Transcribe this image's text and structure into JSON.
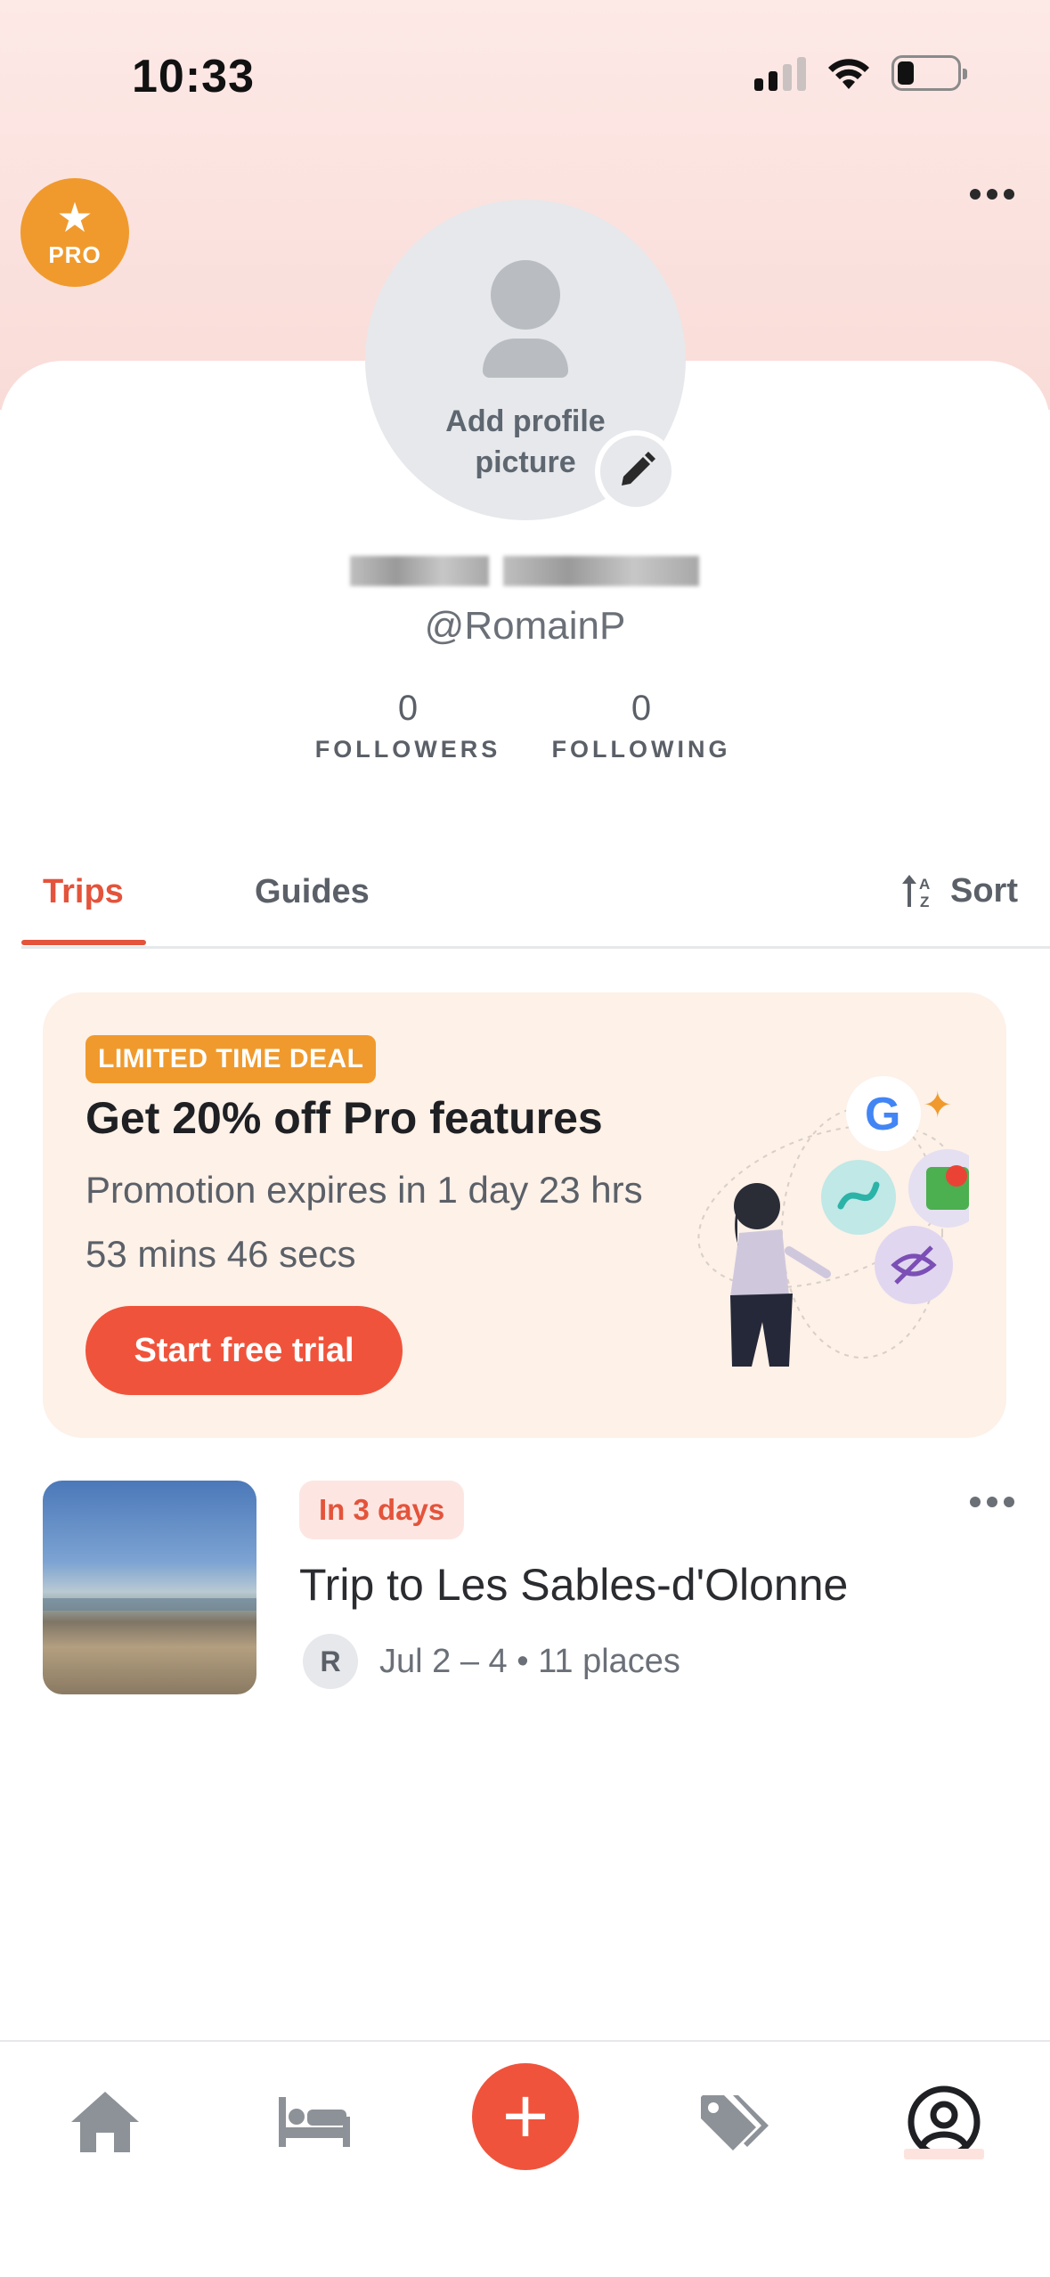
{
  "status_bar": {
    "time": "10:33"
  },
  "header": {
    "pro_label": "PRO"
  },
  "profile": {
    "add_picture_text": "Add profile picture",
    "handle": "@RomainP",
    "followers_count": "0",
    "followers_label": "FOLLOWERS",
    "following_count": "0",
    "following_label": "FOLLOWING"
  },
  "tabs": [
    {
      "label": "Trips",
      "active": true
    },
    {
      "label": "Guides",
      "active": false
    }
  ],
  "sort_label": "Sort",
  "promo": {
    "badge": "LIMITED TIME DEAL",
    "title": "Get 20% off Pro features",
    "description": "Promotion expires in 1 day 23 hrs 53 mins 46 secs",
    "button": "Start free trial"
  },
  "trips": [
    {
      "tag": "In 3 days",
      "title": "Trip to Les Sables-d'Olonne",
      "avatar_initial": "R",
      "meta": "Jul 2 –  4 • 11 places"
    }
  ],
  "nav": {
    "items": [
      "home-icon",
      "bed-icon",
      "add-icon",
      "tags-icon",
      "profile-icon"
    ],
    "add_symbol": "+"
  },
  "colors": {
    "accent": "#f0533b",
    "pro": "#f09a2d",
    "header_bg": "#fde9e6",
    "promo_bg": "#fdf1e8"
  }
}
